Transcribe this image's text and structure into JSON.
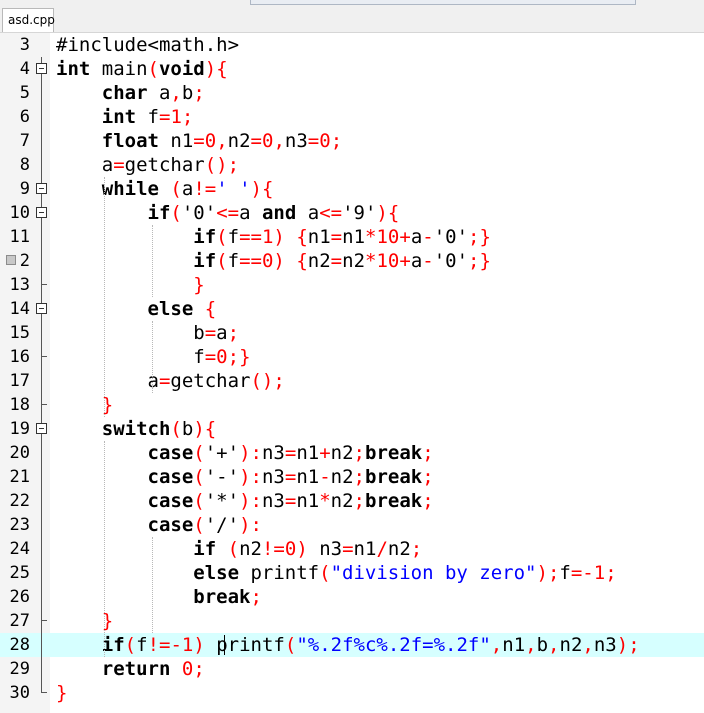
{
  "tab": {
    "filename": "asd.cpp"
  },
  "editor": {
    "current_line": 28,
    "lines": [
      {
        "n": "3",
        "fold": "",
        "tokens": [
          [
            "pp",
            "#include<math.h>"
          ]
        ]
      },
      {
        "n": "4",
        "fold": "open",
        "tokens": [
          [
            "kw",
            "int"
          ],
          [
            "",
            " main"
          ],
          [
            "op",
            "("
          ],
          [
            "kw",
            "void"
          ],
          [
            "op",
            ")"
          ],
          [
            "op",
            "{"
          ]
        ]
      },
      {
        "n": "5",
        "fold": "line",
        "tokens": [
          [
            "",
            "    "
          ],
          [
            "kw",
            "char"
          ],
          [
            "",
            " a"
          ],
          [
            "op",
            ","
          ],
          [
            "",
            "b"
          ],
          [
            "op",
            ";"
          ]
        ]
      },
      {
        "n": "6",
        "fold": "line",
        "tokens": [
          [
            "",
            "    "
          ],
          [
            "kw",
            "int"
          ],
          [
            "",
            " f"
          ],
          [
            "op",
            "="
          ],
          [
            "num",
            "1"
          ],
          [
            "op",
            ";"
          ]
        ]
      },
      {
        "n": "7",
        "fold": "line",
        "tokens": [
          [
            "",
            "    "
          ],
          [
            "kw",
            "float"
          ],
          [
            "",
            " n1"
          ],
          [
            "op",
            "="
          ],
          [
            "num",
            "0"
          ],
          [
            "op",
            ","
          ],
          [
            "",
            "n2"
          ],
          [
            "op",
            "="
          ],
          [
            "num",
            "0"
          ],
          [
            "op",
            ","
          ],
          [
            "",
            "n3"
          ],
          [
            "op",
            "="
          ],
          [
            "num",
            "0"
          ],
          [
            "op",
            ";"
          ]
        ]
      },
      {
        "n": "8",
        "fold": "line",
        "tokens": [
          [
            "",
            "    a"
          ],
          [
            "op",
            "="
          ],
          [
            "",
            "getchar"
          ],
          [
            "op",
            "()"
          ],
          [
            "op",
            ";"
          ]
        ]
      },
      {
        "n": "9",
        "fold": "open",
        "tokens": [
          [
            "",
            "    "
          ],
          [
            "kw",
            "while"
          ],
          [
            "",
            " "
          ],
          [
            "op",
            "("
          ],
          [
            "",
            "a"
          ],
          [
            "op",
            "!="
          ],
          [
            "str",
            "' '"
          ],
          [
            "op",
            ")"
          ],
          [
            "op",
            "{"
          ]
        ]
      },
      {
        "n": "10",
        "fold": "open",
        "tokens": [
          [
            "",
            "        "
          ],
          [
            "kw",
            "if"
          ],
          [
            "op",
            "("
          ],
          [
            "",
            "'0'"
          ],
          [
            "op",
            "<="
          ],
          [
            "",
            "a "
          ],
          [
            "kw",
            "and"
          ],
          [
            "",
            " a"
          ],
          [
            "op",
            "<="
          ],
          [
            "",
            "'9'"
          ],
          [
            "op",
            ")"
          ],
          [
            "op",
            "{"
          ]
        ]
      },
      {
        "n": "11",
        "fold": "line",
        "tokens": [
          [
            "",
            "            "
          ],
          [
            "kw",
            "if"
          ],
          [
            "op",
            "("
          ],
          [
            "",
            "f"
          ],
          [
            "op",
            "=="
          ],
          [
            "num",
            "1"
          ],
          [
            "op",
            ")"
          ],
          [
            "",
            " "
          ],
          [
            "op",
            "{"
          ],
          [
            "",
            "n1"
          ],
          [
            "op",
            "="
          ],
          [
            "",
            "n1"
          ],
          [
            "op",
            "*"
          ],
          [
            "num",
            "10"
          ],
          [
            "op",
            "+"
          ],
          [
            "",
            "a"
          ],
          [
            "op",
            "-"
          ],
          [
            "",
            "'0'"
          ],
          [
            "op",
            ";}"
          ]
        ]
      },
      {
        "n": "12",
        "fold": "line",
        "bookmark": true,
        "tokens": [
          [
            "",
            "            "
          ],
          [
            "kw",
            "if"
          ],
          [
            "op",
            "("
          ],
          [
            "",
            "f"
          ],
          [
            "op",
            "=="
          ],
          [
            "num",
            "0"
          ],
          [
            "op",
            ")"
          ],
          [
            "",
            " "
          ],
          [
            "op",
            "{"
          ],
          [
            "",
            "n2"
          ],
          [
            "op",
            "="
          ],
          [
            "",
            "n2"
          ],
          [
            "op",
            "*"
          ],
          [
            "num",
            "10"
          ],
          [
            "op",
            "+"
          ],
          [
            "",
            "a"
          ],
          [
            "op",
            "-"
          ],
          [
            "",
            "'0'"
          ],
          [
            "op",
            ";}"
          ]
        ]
      },
      {
        "n": "13",
        "fold": "end",
        "tokens": [
          [
            "",
            "            "
          ],
          [
            "op",
            "}"
          ]
        ]
      },
      {
        "n": "14",
        "fold": "open",
        "tokens": [
          [
            "",
            "        "
          ],
          [
            "kw",
            "else"
          ],
          [
            "",
            " "
          ],
          [
            "op",
            "{"
          ]
        ]
      },
      {
        "n": "15",
        "fold": "line",
        "tokens": [
          [
            "",
            "            b"
          ],
          [
            "op",
            "="
          ],
          [
            "",
            "a"
          ],
          [
            "op",
            ";"
          ]
        ]
      },
      {
        "n": "16",
        "fold": "end",
        "tokens": [
          [
            "",
            "            f"
          ],
          [
            "op",
            "="
          ],
          [
            "num",
            "0"
          ],
          [
            "op",
            ";}"
          ]
        ]
      },
      {
        "n": "17",
        "fold": "line",
        "tokens": [
          [
            "",
            "        a"
          ],
          [
            "op",
            "="
          ],
          [
            "",
            "getchar"
          ],
          [
            "op",
            "()"
          ],
          [
            "op",
            ";"
          ]
        ]
      },
      {
        "n": "18",
        "fold": "end",
        "tokens": [
          [
            "",
            "    "
          ],
          [
            "op",
            "}"
          ]
        ]
      },
      {
        "n": "19",
        "fold": "open",
        "tokens": [
          [
            "",
            "    "
          ],
          [
            "kw",
            "switch"
          ],
          [
            "op",
            "("
          ],
          [
            "",
            "b"
          ],
          [
            "op",
            ")"
          ],
          [
            "op",
            "{"
          ]
        ]
      },
      {
        "n": "20",
        "fold": "line",
        "tokens": [
          [
            "",
            "        "
          ],
          [
            "kw",
            "case"
          ],
          [
            "op",
            "("
          ],
          [
            "",
            "'+'"
          ],
          [
            "op",
            ")"
          ],
          [
            "op",
            ":"
          ],
          [
            "",
            "n3"
          ],
          [
            "op",
            "="
          ],
          [
            "",
            "n1"
          ],
          [
            "op",
            "+"
          ],
          [
            "",
            "n2"
          ],
          [
            "op",
            ";"
          ],
          [
            "kw",
            "break"
          ],
          [
            "op",
            ";"
          ]
        ]
      },
      {
        "n": "21",
        "fold": "line",
        "tokens": [
          [
            "",
            "        "
          ],
          [
            "kw",
            "case"
          ],
          [
            "op",
            "("
          ],
          [
            "",
            "'-'"
          ],
          [
            "op",
            ")"
          ],
          [
            "op",
            ":"
          ],
          [
            "",
            "n3"
          ],
          [
            "op",
            "="
          ],
          [
            "",
            "n1"
          ],
          [
            "op",
            "-"
          ],
          [
            "",
            "n2"
          ],
          [
            "op",
            ";"
          ],
          [
            "kw",
            "break"
          ],
          [
            "op",
            ";"
          ]
        ]
      },
      {
        "n": "22",
        "fold": "line",
        "tokens": [
          [
            "",
            "        "
          ],
          [
            "kw",
            "case"
          ],
          [
            "op",
            "("
          ],
          [
            "",
            "'*'"
          ],
          [
            "op",
            ")"
          ],
          [
            "op",
            ":"
          ],
          [
            "",
            "n3"
          ],
          [
            "op",
            "="
          ],
          [
            "",
            "n1"
          ],
          [
            "op",
            "*"
          ],
          [
            "",
            "n2"
          ],
          [
            "op",
            ";"
          ],
          [
            "kw",
            "break"
          ],
          [
            "op",
            ";"
          ]
        ]
      },
      {
        "n": "23",
        "fold": "line",
        "tokens": [
          [
            "",
            "        "
          ],
          [
            "kw",
            "case"
          ],
          [
            "op",
            "("
          ],
          [
            "",
            "'/'"
          ],
          [
            "op",
            ")"
          ],
          [
            "op",
            ":"
          ]
        ]
      },
      {
        "n": "24",
        "fold": "line",
        "tokens": [
          [
            "",
            "            "
          ],
          [
            "kw",
            "if"
          ],
          [
            "",
            " "
          ],
          [
            "op",
            "("
          ],
          [
            "",
            "n2"
          ],
          [
            "op",
            "!="
          ],
          [
            "num",
            "0"
          ],
          [
            "op",
            ")"
          ],
          [
            "",
            " n3"
          ],
          [
            "op",
            "="
          ],
          [
            "",
            "n1"
          ],
          [
            "op",
            "/"
          ],
          [
            "",
            "n2"
          ],
          [
            "op",
            ";"
          ]
        ]
      },
      {
        "n": "25",
        "fold": "line",
        "tokens": [
          [
            "",
            "            "
          ],
          [
            "kw",
            "else"
          ],
          [
            "",
            " printf"
          ],
          [
            "op",
            "("
          ],
          [
            "str",
            "\"division by zero\""
          ],
          [
            "op",
            ")"
          ],
          [
            "op",
            ";"
          ],
          [
            "",
            "f"
          ],
          [
            "op",
            "=-"
          ],
          [
            "num",
            "1"
          ],
          [
            "op",
            ";"
          ]
        ]
      },
      {
        "n": "26",
        "fold": "line",
        "tokens": [
          [
            "",
            "            "
          ],
          [
            "kw",
            "break"
          ],
          [
            "op",
            ";"
          ]
        ]
      },
      {
        "n": "27",
        "fold": "end",
        "tokens": [
          [
            "",
            "    "
          ],
          [
            "op",
            "}"
          ]
        ]
      },
      {
        "n": "28",
        "fold": "line",
        "tokens": [
          [
            "",
            "    "
          ],
          [
            "kw",
            "if"
          ],
          [
            "op",
            "("
          ],
          [
            "",
            "f"
          ],
          [
            "op",
            "!=-"
          ],
          [
            "num",
            "1"
          ],
          [
            "op",
            ")"
          ],
          [
            "",
            " printf"
          ],
          [
            "op",
            "("
          ],
          [
            "str",
            "\"%.2f%c%.2f=%.2f\""
          ],
          [
            "op",
            ","
          ],
          [
            "",
            "n1"
          ],
          [
            "op",
            ","
          ],
          [
            "",
            "b"
          ],
          [
            "op",
            ","
          ],
          [
            "",
            "n2"
          ],
          [
            "op",
            ","
          ],
          [
            "",
            "n3"
          ],
          [
            "op",
            ")"
          ],
          [
            "op",
            ";"
          ]
        ]
      },
      {
        "n": "29",
        "fold": "line",
        "tokens": [
          [
            "",
            "    "
          ],
          [
            "kw",
            "return"
          ],
          [
            "",
            " "
          ],
          [
            "num",
            "0"
          ],
          [
            "op",
            ";"
          ]
        ]
      },
      {
        "n": "30",
        "fold": "end",
        "tokens": [
          [
            "op",
            "}"
          ]
        ]
      }
    ]
  },
  "colors": {
    "keyword": "#000000",
    "operator": "#ff0000",
    "number": "#ff0000",
    "string": "#0000ff",
    "current_line_bg": "#d6ffff"
  }
}
